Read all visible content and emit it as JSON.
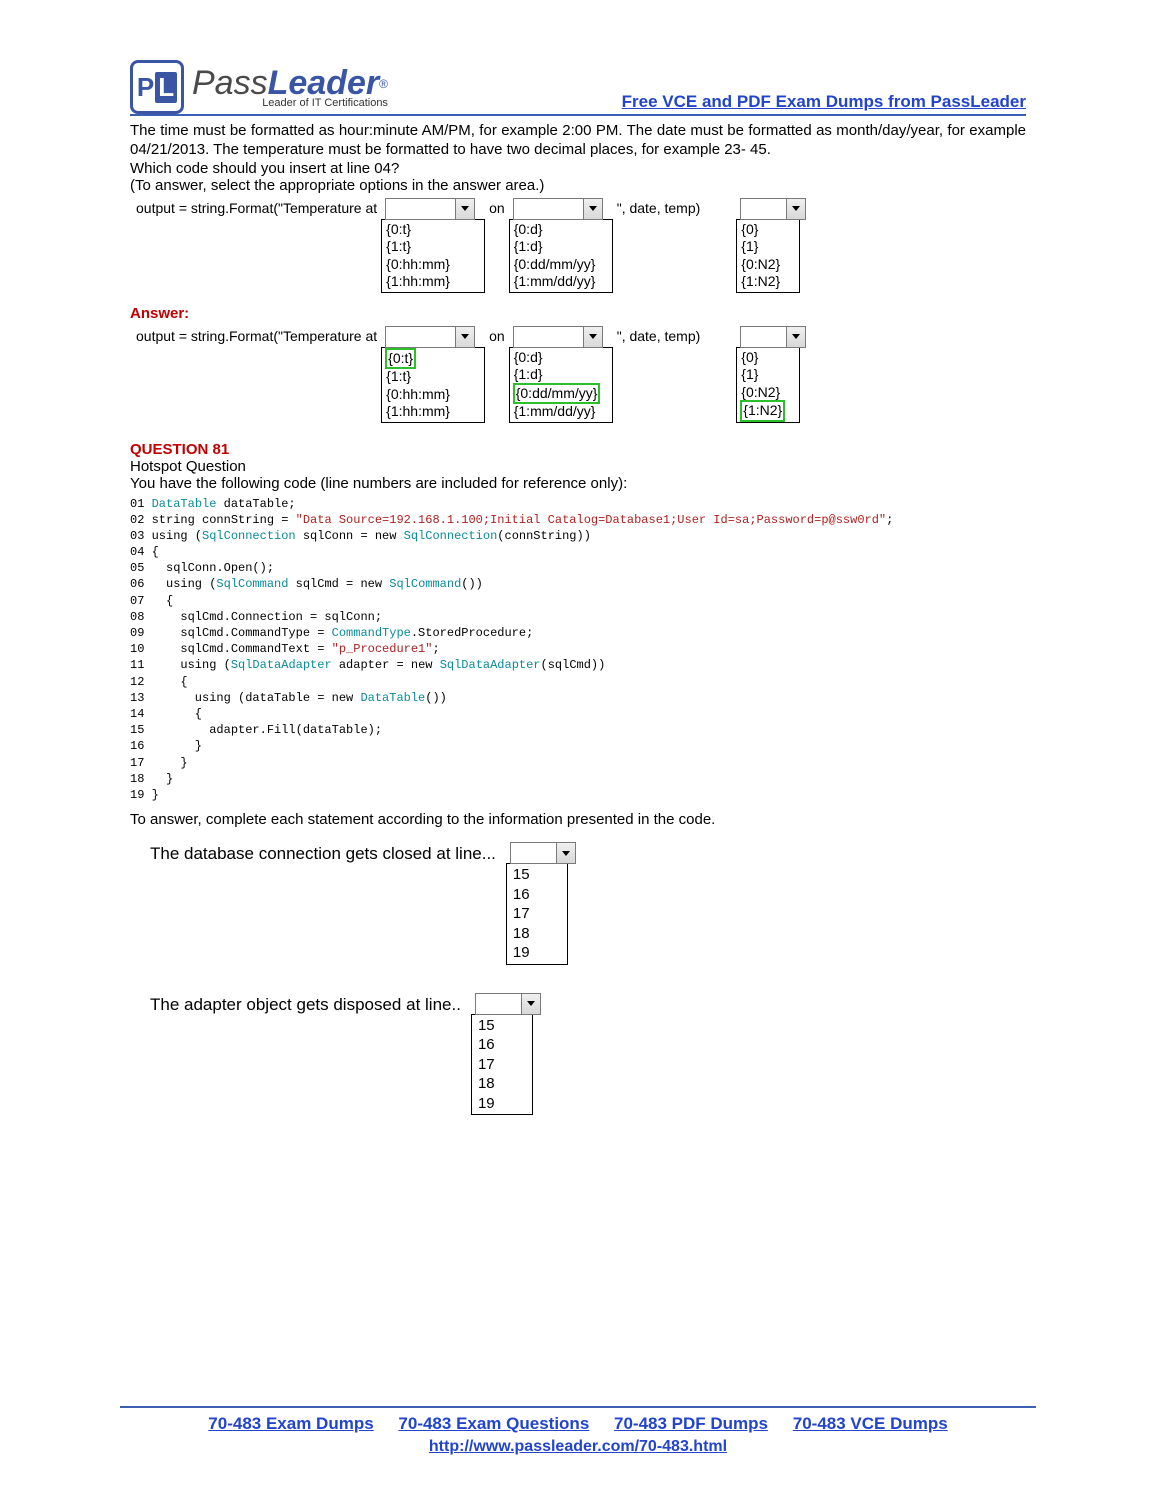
{
  "header": {
    "logo_pass": "Pass",
    "logo_leader": "Leader",
    "logo_reg": "®",
    "logo_tag": "Leader of IT Certifications",
    "top_link": "Free VCE and PDF Exam Dumps from PassLeader"
  },
  "intro": {
    "p1": "The time must be formatted as hour:minute AM/PM, for example 2:00 PM. The date must be formatted as month/day/year, for example 04/21/2013. The temperature must be formatted to have two decimal places, for example 23- 45.",
    "p2": "Which code should you insert at line 04?",
    "p3": "(To answer, select the appropriate options in the answer area.)"
  },
  "q80": {
    "lead": "output = string.Format(\"Temperature at",
    "on": "on",
    "tail": "\", date, temp)",
    "col1": [
      "{0:t}",
      "{1:t}",
      "{0:hh:mm}",
      "{1:hh:mm}"
    ],
    "col2": [
      "{0:d}",
      "{1:d}",
      "{0:dd/mm/yy}",
      "{1:mm/dd/yy}"
    ],
    "col3": [
      "{0}",
      "{1}",
      "{0:N2}",
      "{1:N2}"
    ],
    "answer_label": "Answer:",
    "ans_col1_hl": 0,
    "ans_col2_hl": 2,
    "ans_col3_hl": 3
  },
  "q81": {
    "label": "QUESTION 81",
    "subtitle": "Hotspot Question",
    "prompt": "You have the following code (line numbers are included for reference only):",
    "code": "01 DataTable dataTable;\n02 string connString = \"Data Source=192.168.1.100;Initial Catalog=Database1;User Id=sa;Password=p@ssw0rd\";\n03 using (SqlConnection sqlConn = new SqlConnection(connString))\n04 {\n05   sqlConn.Open();\n06   using (SqlCommand sqlCmd = new SqlCommand())\n07   {\n08     sqlCmd.Connection = sqlConn;\n09     sqlCmd.CommandType = CommandType.StoredProcedure;\n10     sqlCmd.CommandText = \"p_Procedure1\";\n11     using (SqlDataAdapter adapter = new SqlDataAdapter(sqlCmd))\n12     {\n13       using (dataTable = new DataTable())\n14       {\n15         adapter.Fill(dataTable);\n16       }\n17     }\n18   }\n19 }",
    "after": "To answer, complete each statement according to the information presented in the code.",
    "stmt1": "The database connection gets closed at line...",
    "stmt2": "The adapter object gets disposed at line..",
    "options": [
      "15",
      "16",
      "17",
      "18",
      "19"
    ]
  },
  "footer": {
    "links": [
      "70-483 Exam Dumps",
      "70-483 Exam Questions",
      "70-483 PDF Dumps",
      "70-483 VCE Dumps"
    ],
    "url": "http://www.passleader.com/70-483.html"
  }
}
